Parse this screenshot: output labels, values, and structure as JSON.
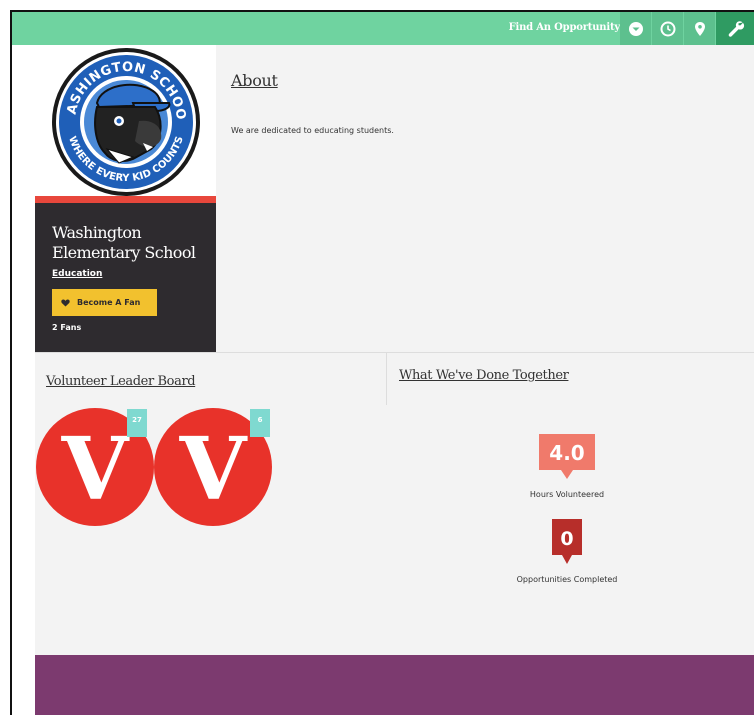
{
  "topbar": {
    "find_label": "Find An Opportunity",
    "icons": [
      "chevron-down-icon",
      "clock-icon",
      "map-pin-icon",
      "wrench-icon"
    ]
  },
  "org": {
    "logo_text_top": "WASHINGTON SCHOOL",
    "logo_text_bottom": "WHERE EVERY KID COUNTS",
    "name": "Washington Elementary School",
    "category": "Education",
    "fan_button_label": "Become A Fan",
    "fans_count": "2 Fans"
  },
  "about": {
    "title": "About",
    "text": "We are dedicated to educating students."
  },
  "leaderboard": {
    "title": "Volunteer Leader Board",
    "volunteers": [
      {
        "initial": "V",
        "hours": "27"
      },
      {
        "initial": "V",
        "hours": "6"
      }
    ]
  },
  "together": {
    "title": "What We've Done Together",
    "hours_value": "4.0",
    "hours_label": "Hours Volunteered",
    "opps_value": "0",
    "opps_label": "Opportunities Completed"
  },
  "colors": {
    "topbar": "#6fd3a0",
    "accent_red": "#e8473c",
    "card_dark": "#2e2b2f",
    "fan_yellow": "#f2c12e",
    "badge_teal": "#7fd9d0",
    "hours_salmon": "#f07a6b",
    "opps_darkred": "#b72e2a",
    "footer_purple": "#7c3a6f"
  }
}
